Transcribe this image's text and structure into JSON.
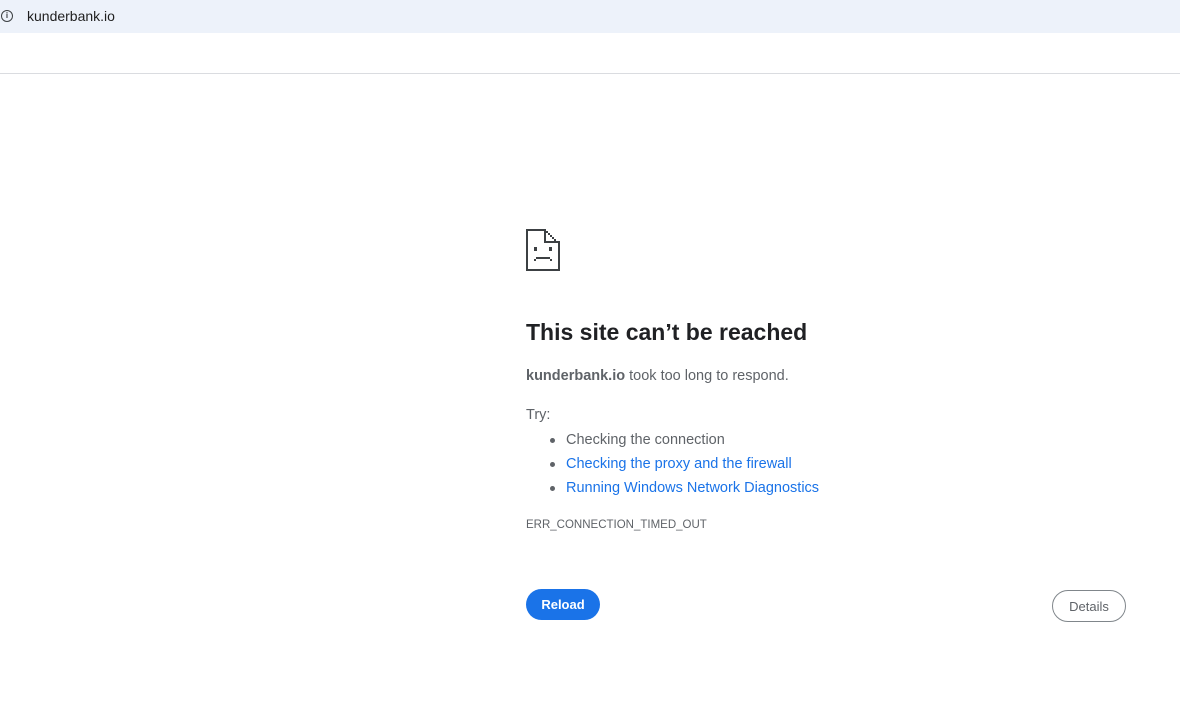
{
  "browser": {
    "url": "kunderbank.io",
    "info_icon": "info-icon"
  },
  "error_page": {
    "icon": "sad-page-icon",
    "title": "This site can’t be reached",
    "summary_host": "kunderbank.io",
    "summary_rest": " took too long to respond.",
    "try_label": "Try:",
    "suggestions": [
      {
        "label": "Checking the connection",
        "is_link": false
      },
      {
        "label": "Checking the proxy and the firewall",
        "is_link": true
      },
      {
        "label": "Running Windows Network Diagnostics",
        "is_link": true
      }
    ],
    "error_code": "ERR_CONNECTION_TIMED_OUT",
    "reload_label": "Reload",
    "details_label": "Details"
  },
  "colors": {
    "accent": "#1a73e8",
    "address_bar_bg": "#edf2fa",
    "body_text": "#5f6368",
    "title_text": "#202124"
  }
}
